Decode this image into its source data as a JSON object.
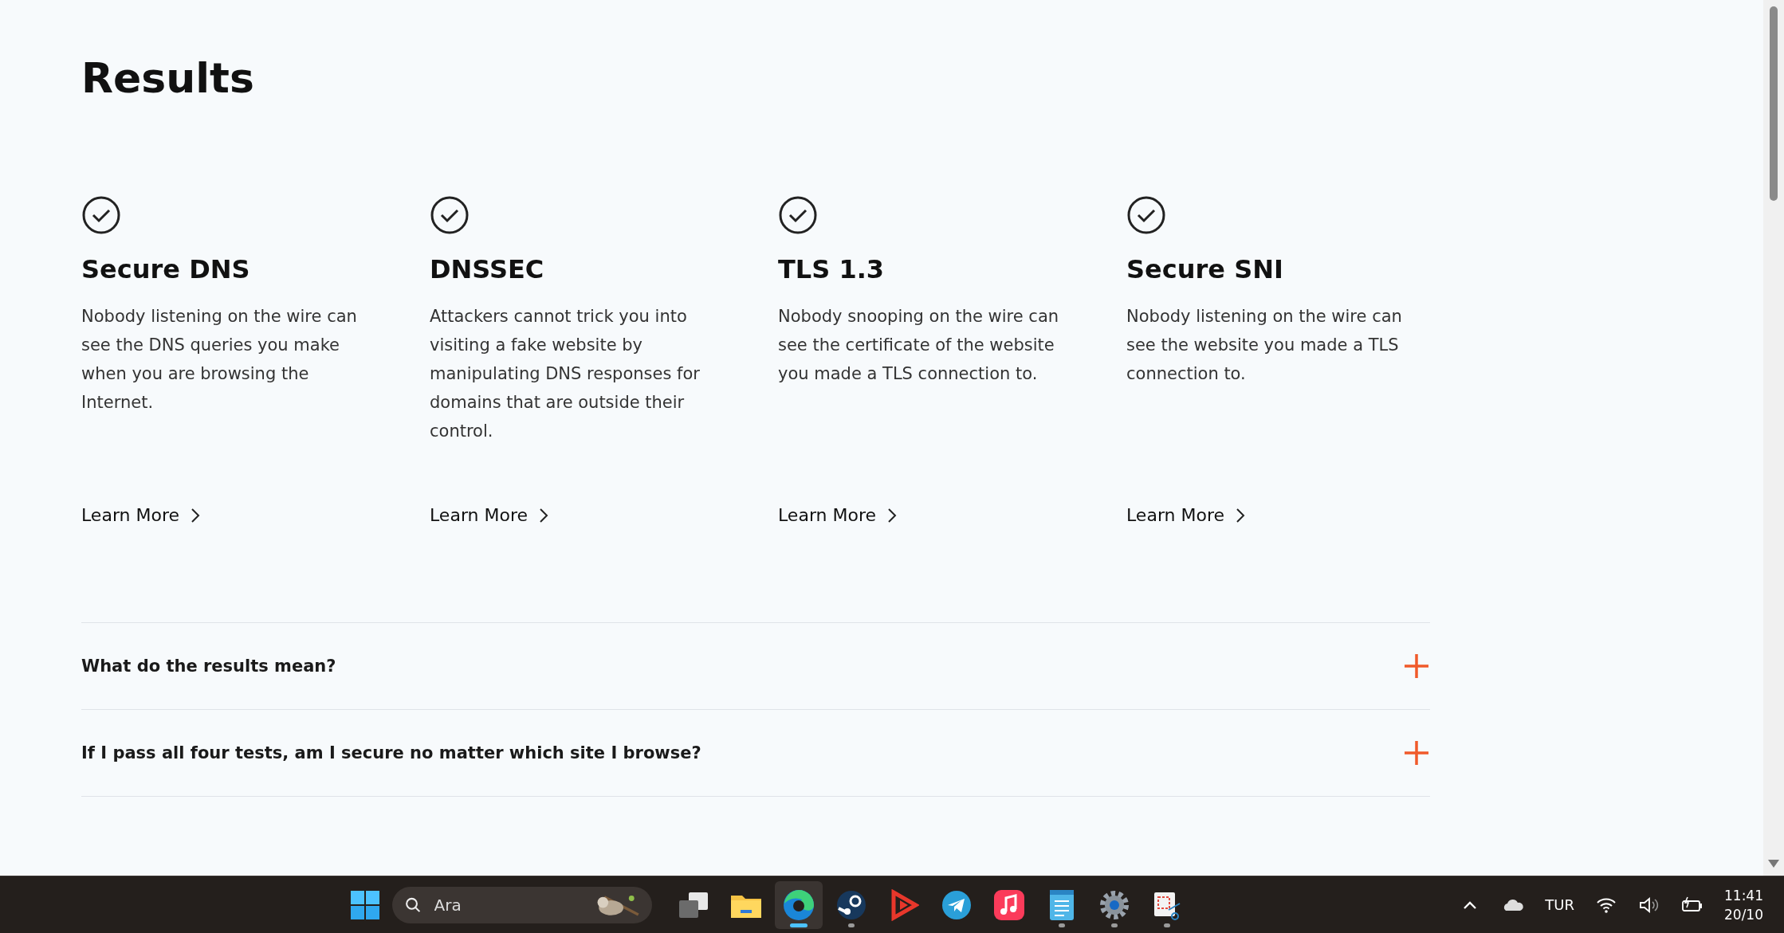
{
  "page": {
    "title": "Results"
  },
  "results": [
    {
      "title": "Secure DNS",
      "passed": true,
      "description": "Nobody listening on the wire can see the DNS queries you make when you are browsing the Internet.",
      "link": "Learn More"
    },
    {
      "title": "DNSSEC",
      "passed": true,
      "description": "Attackers cannot trick you into visiting a fake website by manipulating DNS responses for domains that are outside their control.",
      "link": "Learn More"
    },
    {
      "title": "TLS 1.3",
      "passed": true,
      "description": "Nobody snooping on the wire can see the certificate of the website you made a TLS connection to.",
      "link": "Learn More"
    },
    {
      "title": "Secure SNI",
      "passed": true,
      "description": "Nobody listening on the wire can see the website you made a TLS connection to.",
      "link": "Learn More"
    }
  ],
  "faq": [
    {
      "question": "What do the results mean?",
      "expanded": false
    },
    {
      "question": "If I pass all four tests, am I secure no matter which site I browse?",
      "expanded": false
    }
  ],
  "taskbar": {
    "search": {
      "placeholder": "Ara"
    },
    "apps": [
      {
        "kind": "task-view",
        "running": false,
        "selected": false
      },
      {
        "kind": "folder",
        "running": false,
        "selected": false
      },
      {
        "kind": "browser",
        "running": true,
        "selected": true
      },
      {
        "kind": "steam",
        "running": true,
        "selected": false
      },
      {
        "kind": "play",
        "running": false,
        "selected": false
      },
      {
        "kind": "telegram",
        "running": false,
        "selected": false
      },
      {
        "kind": "music",
        "running": false,
        "selected": false
      },
      {
        "kind": "notepad",
        "running": true,
        "selected": false
      },
      {
        "kind": "settings",
        "running": true,
        "selected": false
      },
      {
        "kind": "snipping",
        "running": true,
        "selected": false
      }
    ],
    "language": "TUR",
    "time": "11:41",
    "date": "20/10"
  }
}
